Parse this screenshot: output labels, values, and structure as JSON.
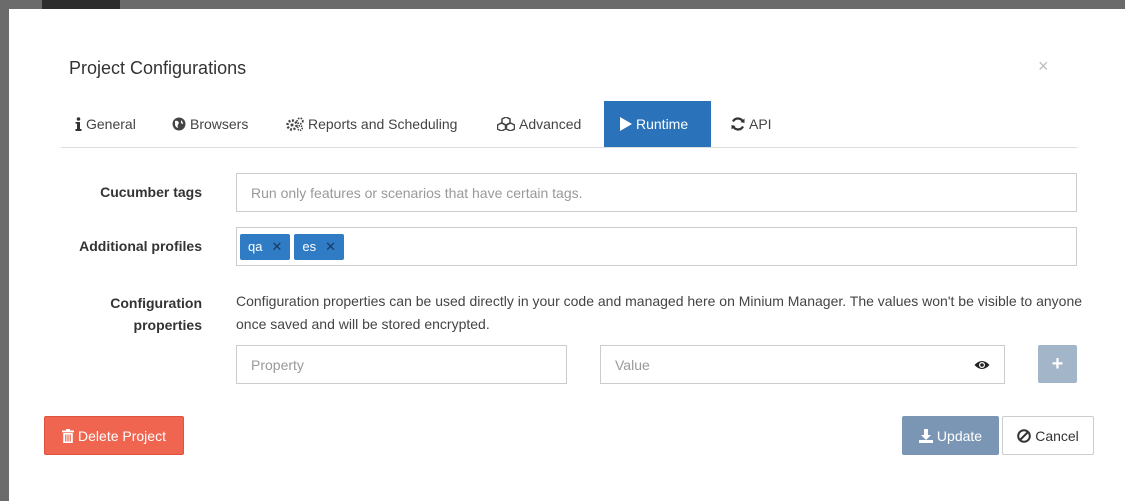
{
  "dialog": {
    "title": "Project Configurations",
    "close_label": "×"
  },
  "tabs": [
    {
      "label": "General",
      "icon": "info-icon"
    },
    {
      "label": "Browsers",
      "icon": "globe-icon"
    },
    {
      "label": "Reports and Scheduling",
      "icon": "gears-icon"
    },
    {
      "label": "Advanced",
      "icon": "cubes-icon"
    },
    {
      "label": "Runtime",
      "icon": "play-icon",
      "active": true
    },
    {
      "label": "API",
      "icon": "refresh-icon"
    }
  ],
  "form": {
    "cucumber_tags": {
      "label": "Cucumber tags",
      "placeholder": "Run only features or scenarios that have certain tags.",
      "value": ""
    },
    "additional_profiles": {
      "label": "Additional profiles",
      "chips": [
        "qa",
        "es"
      ],
      "remove_symbol": "✕"
    },
    "configuration_properties": {
      "label_line1": "Configuration",
      "label_line2": "properties",
      "description": "Configuration properties can be used directly in your code and managed here on Minium Manager. The values won't be visible to anyone once saved and will be stored encrypted.",
      "property_placeholder": "Property",
      "value_placeholder": "Value",
      "add_symbol": "+"
    }
  },
  "buttons": {
    "delete": "Delete Project",
    "update": "Update",
    "cancel": "Cancel"
  },
  "colors": {
    "active_tab": "#2a72b9",
    "chip": "#2f7bc4",
    "delete": "#f06550",
    "update": "#7b96b4",
    "add": "#a2b5c9"
  }
}
